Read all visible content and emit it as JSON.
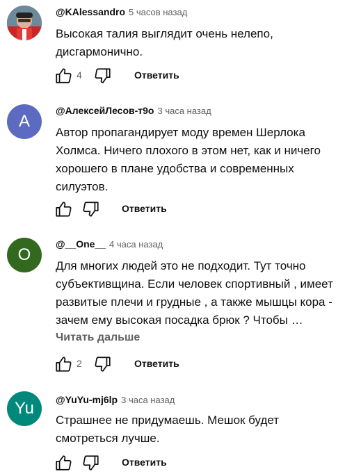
{
  "comments": [
    {
      "author": "@KAlessandro",
      "time": "5 часов назад",
      "avatar_letter": "",
      "avatar_color": "#8c1c1c",
      "text_lines": [
        "Высокая талия выглядит очень нелепо,",
        "дисгармонично."
      ],
      "likes": "4",
      "reply_label": "Ответить"
    },
    {
      "author": "@АлексейЛесов-т9о",
      "time": "3 часа назад",
      "avatar_letter": "A",
      "avatar_color": "#5c6bc0",
      "text_lines": [
        "Автор пропагандирует моду времен Шерлока",
        "Холмса. Ничего плохого в этом нет, как и ничего",
        "хорошего в плане удобства и современных",
        "силуэтов."
      ],
      "likes": "",
      "reply_label": "Ответить"
    },
    {
      "author": "@__One__",
      "time": "4 часа назад",
      "avatar_letter": "O",
      "avatar_color": "#33691e",
      "text_lines": [
        "Для многих людей это не подходит. Тут точно",
        "субъективщина. Если человек спортивный , имеет",
        "развитые плечи и грудные , а также мышцы кора -",
        "зачем ему высокая посадка брюк ? Чтобы"
      ],
      "ellipsis": "…",
      "read_more": "Читать дальше",
      "likes": "2",
      "reply_label": "Ответить"
    },
    {
      "author": "@YuYu-mj6lp",
      "time": "3 часа назад",
      "avatar_letter": "Yu",
      "avatar_color": "#00897b",
      "text_lines": [
        "Страшнее не придумаешь. Мешок будет",
        "смотреться лучше."
      ],
      "likes": "",
      "reply_label": "Ответить"
    }
  ],
  "icons": {
    "like": "thumbs-up-icon",
    "dislike": "thumbs-down-icon"
  }
}
